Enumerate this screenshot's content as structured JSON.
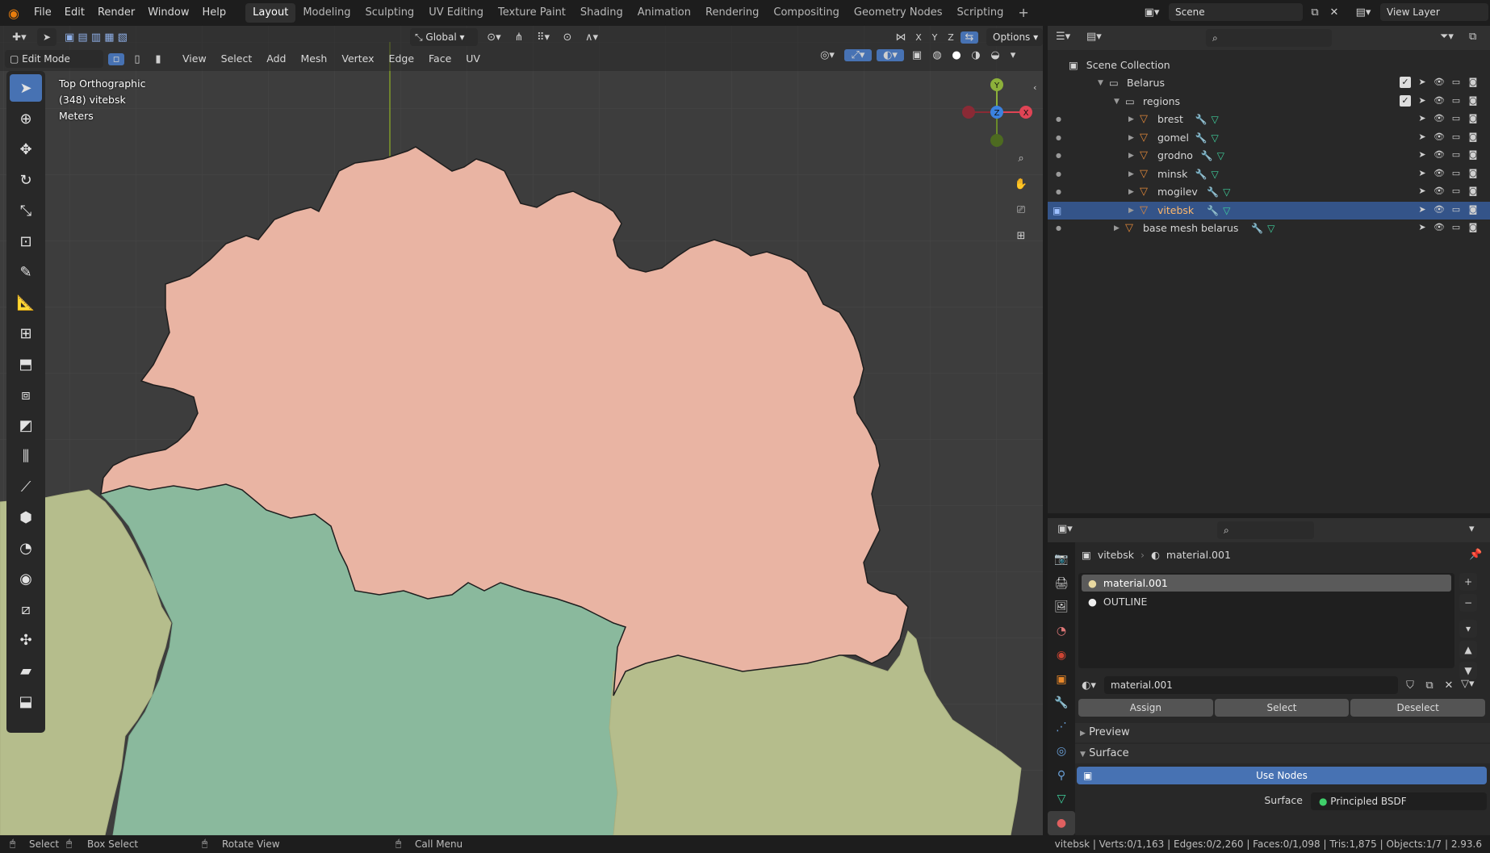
{
  "menus": [
    "File",
    "Edit",
    "Render",
    "Window",
    "Help"
  ],
  "workspaces": [
    {
      "label": "Layout",
      "active": true
    },
    {
      "label": "Modeling"
    },
    {
      "label": "Sculpting"
    },
    {
      "label": "UV Editing"
    },
    {
      "label": "Texture Paint"
    },
    {
      "label": "Shading"
    },
    {
      "label": "Animation"
    },
    {
      "label": "Rendering"
    },
    {
      "label": "Compositing"
    },
    {
      "label": "Geometry Nodes"
    },
    {
      "label": "Scripting"
    }
  ],
  "topbar": {
    "add_tab": "+",
    "scene": "Scene",
    "view_layer": "View Layer"
  },
  "viewport": {
    "mode": "Edit Mode",
    "menu": [
      "View",
      "Select",
      "Add",
      "Mesh",
      "Vertex",
      "Edge",
      "Face",
      "UV"
    ],
    "transform_orientation": "Global",
    "options_label": "Options",
    "axis_x": "X",
    "axis_y": "Y",
    "axis_z": "Z",
    "info_line1": "Top Orthographic",
    "info_line2": "(348) vitebsk",
    "info_line3": "Meters",
    "gizmo": {
      "y": "Y",
      "x": "X",
      "z": "Z"
    },
    "region_colors": {
      "vitebsk": "#e9b4a3",
      "minsk": "#8ab99d",
      "grodno": "#b5bd8c",
      "mogilev": "#b5bd8c"
    }
  },
  "outliner": {
    "root": "Scene Collection",
    "items": [
      {
        "label": "Belarus",
        "type": "collection",
        "level": 1
      },
      {
        "label": "regions",
        "type": "collection",
        "level": 2
      },
      {
        "label": "brest",
        "type": "mesh",
        "level": 3
      },
      {
        "label": "gomel",
        "type": "mesh",
        "level": 3
      },
      {
        "label": "grodno",
        "type": "mesh",
        "level": 3
      },
      {
        "label": "minsk",
        "type": "mesh",
        "level": 3
      },
      {
        "label": "mogilev",
        "type": "mesh",
        "level": 3
      },
      {
        "label": "vitebsk",
        "type": "mesh",
        "level": 3,
        "selected": true
      },
      {
        "label": "base mesh belarus",
        "type": "mesh",
        "level": 2
      }
    ]
  },
  "properties": {
    "breadcrumb_object": "vitebsk",
    "breadcrumb_material": "material.001",
    "slots": [
      {
        "label": "material.001",
        "selected": true
      },
      {
        "label": "OUTLINE"
      }
    ],
    "material_name": "material.001",
    "assign": "Assign",
    "select": "Select",
    "deselect": "Deselect",
    "preview": "Preview",
    "surface": "Surface",
    "use_nodes": "Use Nodes",
    "surface_label": "Surface",
    "surface_value": "Principled BSDF"
  },
  "statusbar": {
    "select": "Select",
    "box_select": "Box Select",
    "rotate_view": "Rotate View",
    "call_menu": "Call Menu",
    "stats": "vitebsk | Verts:0/1,163 | Edges:0/2,260 | Faces:0/1,098 | Tris:1,875 | Objects:1/7 | 2.93.6"
  }
}
